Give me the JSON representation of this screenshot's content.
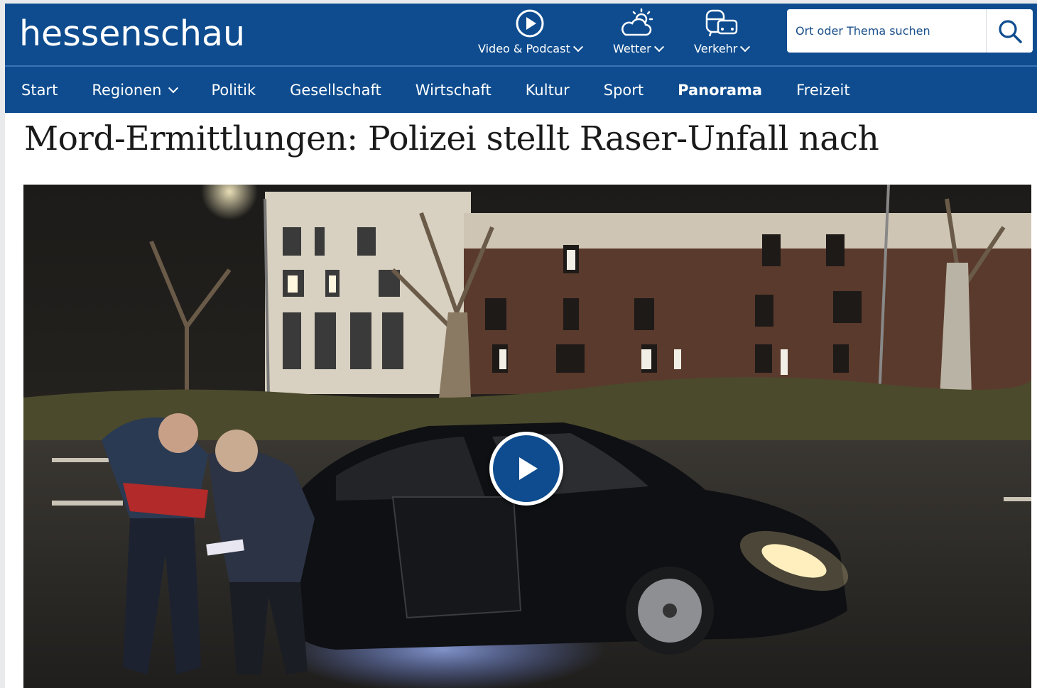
{
  "header": {
    "logo": "hessenschau",
    "tools": [
      {
        "label": "Video & Podcast",
        "icon": "play-circle-icon"
      },
      {
        "label": "Wetter",
        "icon": "weather-icon"
      },
      {
        "label": "Verkehr",
        "icon": "traffic-icon"
      }
    ],
    "search": {
      "placeholder": "Ort oder Thema suchen",
      "icon": "search-icon"
    }
  },
  "nav": {
    "items": [
      {
        "label": "Start"
      },
      {
        "label": "Regionen"
      },
      {
        "label": "Politik"
      },
      {
        "label": "Gesellschaft"
      },
      {
        "label": "Wirtschaft"
      },
      {
        "label": "Kultur"
      },
      {
        "label": "Sport"
      },
      {
        "label": "Panorama"
      },
      {
        "label": "Freizeit"
      }
    ],
    "active": "Panorama"
  },
  "article": {
    "headline": "Mord-Ermittlungen: Polizei stellt Raser-Unfall nach",
    "video": {
      "play_icon": "play-icon"
    }
  },
  "colors": {
    "brand": "#0e4c8f",
    "text": "#1a1a1a",
    "background": "#ffffff"
  }
}
